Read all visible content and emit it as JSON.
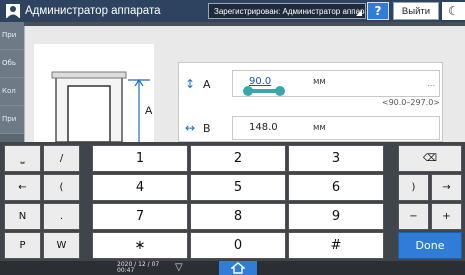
{
  "header": {
    "title": "Администратор аппарата",
    "login_status": "Зарегистрирован: Администратор аппарат",
    "help_label": "?",
    "logout_label": "Выйти",
    "power_glyph": "☾"
  },
  "sidebar": {
    "tabs": [
      {
        "label": "При"
      },
      {
        "label": "Обь"
      },
      {
        "label": "Кол"
      },
      {
        "label": "При"
      }
    ]
  },
  "dimension_a": {
    "icon": "arrows-vertical-icon",
    "icon_glyph": "↕",
    "label": "A",
    "value": "90.0",
    "unit": "мм",
    "range": "<90.0–297.0>",
    "ellipsis": "..."
  },
  "dimension_b": {
    "icon": "arrows-horizontal-icon",
    "icon_glyph": "↔",
    "label": "B",
    "value": "148.0",
    "unit": "мм"
  },
  "diagram": {
    "label": "A"
  },
  "keyboard": {
    "left_keys": [
      [
        "⎵",
        "/"
      ],
      [
        "←",
        "("
      ],
      [
        "N",
        "."
      ],
      [
        "P",
        "W"
      ]
    ],
    "num_keys": [
      [
        "1",
        "2",
        "3"
      ],
      [
        "4",
        "5",
        "6"
      ],
      [
        "7",
        "8",
        "9"
      ],
      [
        "∗",
        "0",
        "#"
      ]
    ],
    "right_keys": [
      [
        "⌫"
      ],
      [
        ")",
        "→"
      ],
      [
        "−",
        "+"
      ]
    ],
    "done_label": "Done"
  },
  "status": {
    "date": "2020 / 12 / 07",
    "time": "00:47",
    "tri_glyph": "▽"
  },
  "colors": {
    "accent": "#2f7dd6",
    "header": "#2d4360"
  }
}
